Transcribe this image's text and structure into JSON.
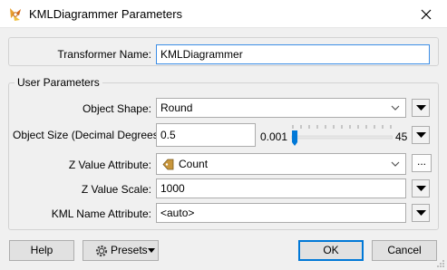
{
  "window": {
    "title": "KMLDiagrammer Parameters"
  },
  "transformer": {
    "label": "Transformer Name:",
    "value": "KMLDiagrammer"
  },
  "group": {
    "label": "User Parameters"
  },
  "params": {
    "object_shape": {
      "label": "Object Shape:",
      "value": "Round"
    },
    "object_size": {
      "label": "Object Size (Decimal Degrees):",
      "value": "0.5",
      "slider_min": "0.001",
      "slider_max": "45",
      "slider_fraction": 0.01
    },
    "z_value_attribute": {
      "label": "Z Value Attribute:",
      "value": "Count",
      "browse_label": "..."
    },
    "z_value_scale": {
      "label": "Z Value Scale:",
      "value": "1000"
    },
    "kml_name_attribute": {
      "label": "KML Name Attribute:",
      "value": "<auto>"
    }
  },
  "footer": {
    "help": "Help",
    "presets": "Presets",
    "ok": "OK",
    "cancel": "Cancel"
  },
  "colors": {
    "accent": "#0078d7",
    "focus_border": "#3d8ee6",
    "slider_thumb": "#0078d7",
    "attribute_icon": "#c8963c"
  },
  "icons": [
    "fme-transformer-icon",
    "close-icon",
    "chevron-down-icon",
    "menu-arrow-icon",
    "attribute-icon",
    "gear-icon",
    "resize-grip-icon"
  ]
}
